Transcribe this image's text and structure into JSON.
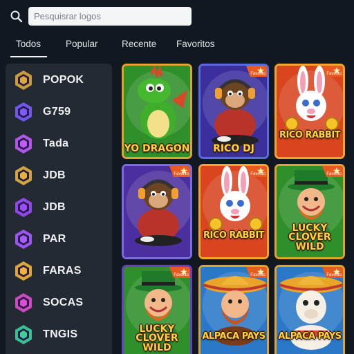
{
  "search": {
    "placeholder": "Pesquisrar logos"
  },
  "tabs": [
    {
      "label": "Todos",
      "active": true
    },
    {
      "label": "Popular"
    },
    {
      "label": "Recente"
    },
    {
      "label": "Favoritos"
    }
  ],
  "providers": [
    {
      "label": "POPOK",
      "icon": "popok-logo-icon",
      "color": "#d9a93a"
    },
    {
      "label": "G759",
      "icon": "g759-logo-icon",
      "color": "#7b5cff"
    },
    {
      "label": "Tada",
      "icon": "tada-logo-icon",
      "color": "#c05cff"
    },
    {
      "label": "JDB",
      "icon": "jdb-gold-logo-icon",
      "color": "#e3b33c"
    },
    {
      "label": "JDB",
      "icon": "jdb-purple-logo-icon",
      "color": "#9b4dff"
    },
    {
      "label": "PAR",
      "icon": "par-logo-icon",
      "color": "#a75cff"
    },
    {
      "label": "FARAS",
      "icon": "faras-logo-icon",
      "color": "#f0b53a"
    },
    {
      "label": "SOCAS",
      "icon": "socas-logo-icon",
      "color": "#e04ccf"
    },
    {
      "label": "TNGIS",
      "icon": "tngis-logo-icon",
      "color": "#3ccf9a"
    }
  ],
  "games": [
    {
      "title": "YO DRAGON",
      "favorite": false,
      "bg": "#2f8f2a",
      "border": "#e0a42a",
      "art": "dragon"
    },
    {
      "title": "RICO DJ",
      "favorite": true,
      "bg": "#3b2f9e",
      "border": "#5a6be0",
      "art": "monkey"
    },
    {
      "title": "RICO RABBIT",
      "favorite": true,
      "bg": "#d8451f",
      "border": "#f0a72a",
      "art": "rabbit"
    },
    {
      "title": "",
      "favorite": true,
      "bg": "#4c2f9e",
      "border": "#7a6be0",
      "art": "monkey"
    },
    {
      "title": "RICO RABBIT",
      "favorite": true,
      "bg": "#d8451f",
      "border": "#f0a72a",
      "art": "rabbit"
    },
    {
      "title": "LUCKY CLOVER WILD",
      "favorite": true,
      "bg": "#2f8f2a",
      "border": "#e0a42a",
      "art": "leprechaun"
    },
    {
      "title": "LUCKY CLOVER WILD",
      "favorite": true,
      "bg": "#2f8f2a",
      "border": "#6a3fd0",
      "art": "leprechaun"
    },
    {
      "title": "ALPACA PAYS",
      "favorite": true,
      "bg": "#2b78c8",
      "border": "#e0a42a",
      "art": "alpaca-man"
    },
    {
      "title": "ALPACA PAYS",
      "favorite": true,
      "bg": "#2b78c8",
      "border": "#e0a42a",
      "art": "alpaca"
    }
  ],
  "favorite_label": "Favorito"
}
